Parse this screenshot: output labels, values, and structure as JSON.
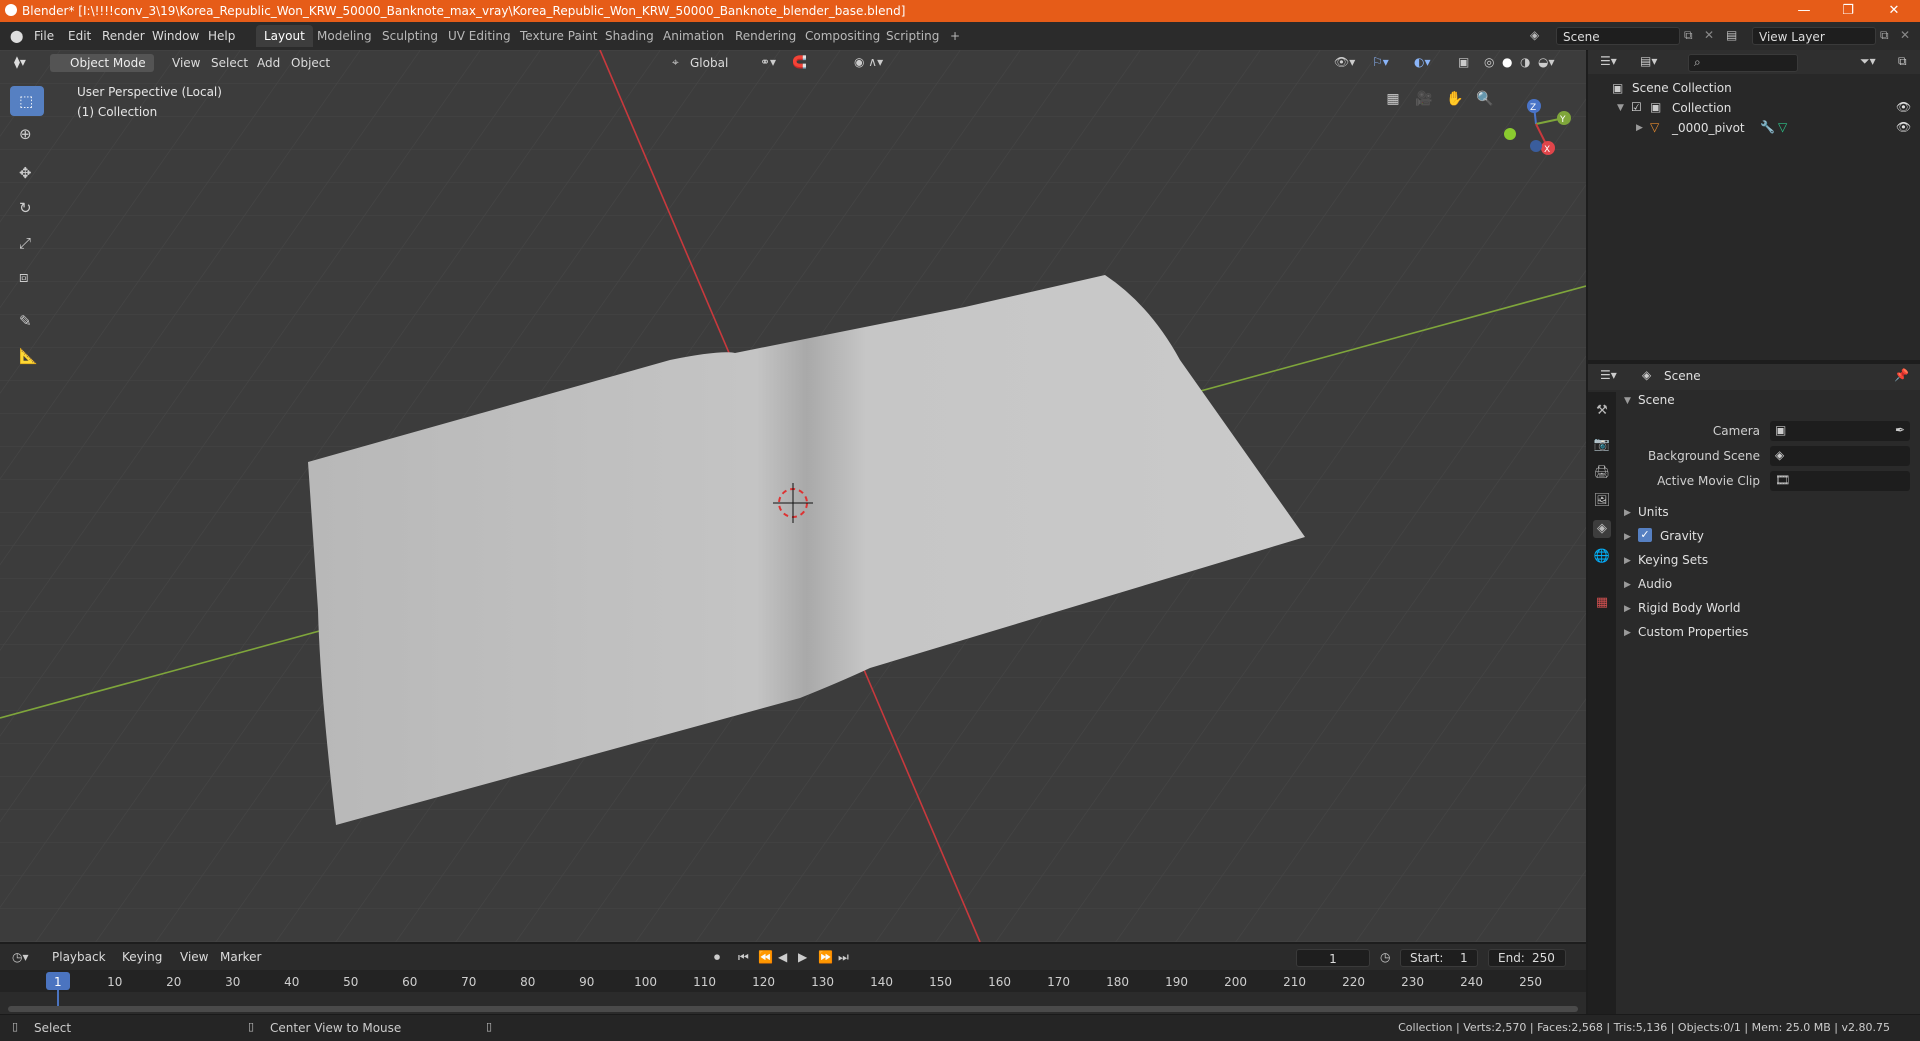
{
  "window": {
    "title": "Blender* [I:\\!!!!conv_3\\19\\Korea_Republic_Won_KRW_50000_Banknote_max_vray\\Korea_Republic_Won_KRW_50000_Banknote_blender_base.blend]",
    "controls": {
      "minimize": "—",
      "maximize": "❐",
      "close": "✕"
    }
  },
  "menu": [
    "File",
    "Edit",
    "Render",
    "Window",
    "Help"
  ],
  "workspaces": [
    "Layout",
    "Modeling",
    "Sculpting",
    "UV Editing",
    "Texture Paint",
    "Shading",
    "Animation",
    "Rendering",
    "Compositing",
    "Scripting"
  ],
  "active_workspace": "Layout",
  "add_workspace": "+",
  "scene_selector": "Scene",
  "view_layer_selector": "View Layer",
  "viewport": {
    "mode": "Object Mode",
    "menus": [
      "View",
      "Select",
      "Add",
      "Object"
    ],
    "orientation": "Global",
    "overlay_text_1": "User Perspective (Local)",
    "overlay_text_2": "(1) Collection",
    "gizmo_labels": {
      "x": "X",
      "y": "Y",
      "z": "Z"
    }
  },
  "outliner": {
    "root": "Scene Collection",
    "collection": "Collection",
    "object": "_0000_pivot"
  },
  "properties": {
    "header_title": "Scene",
    "panel_title": "Scene",
    "fields": [
      {
        "label": "Camera",
        "value": ""
      },
      {
        "label": "Background Scene",
        "value": ""
      },
      {
        "label": "Active Movie Clip",
        "value": ""
      }
    ],
    "subpanels": [
      "Units",
      "Gravity",
      "Keying Sets",
      "Audio",
      "Rigid Body World",
      "Custom Properties"
    ],
    "gravity_checked": true
  },
  "timeline": {
    "menus": [
      "Playback",
      "Keying",
      "View",
      "Marker"
    ],
    "current_frame": "1",
    "start_label": "Start:",
    "start": "1",
    "end_label": "End:",
    "end": "250",
    "ruler": [
      "1",
      "10",
      "20",
      "30",
      "40",
      "50",
      "60",
      "70",
      "80",
      "90",
      "100",
      "110",
      "120",
      "130",
      "140",
      "150",
      "160",
      "170",
      "180",
      "190",
      "200",
      "210",
      "220",
      "230",
      "240",
      "250"
    ]
  },
  "statusbar": {
    "left1": "Select",
    "left2": "Center View to Mouse",
    "right": "Collection | Verts:2,570 | Faces:2,568 | Tris:5,136 | Objects:0/1 | Mem: 25.0 MB | v2.80.75"
  },
  "colors": {
    "title_bar": "#e65c18",
    "accent": "#5680c2",
    "axis_x": "#c8393d",
    "axis_y": "#7fa63b"
  }
}
